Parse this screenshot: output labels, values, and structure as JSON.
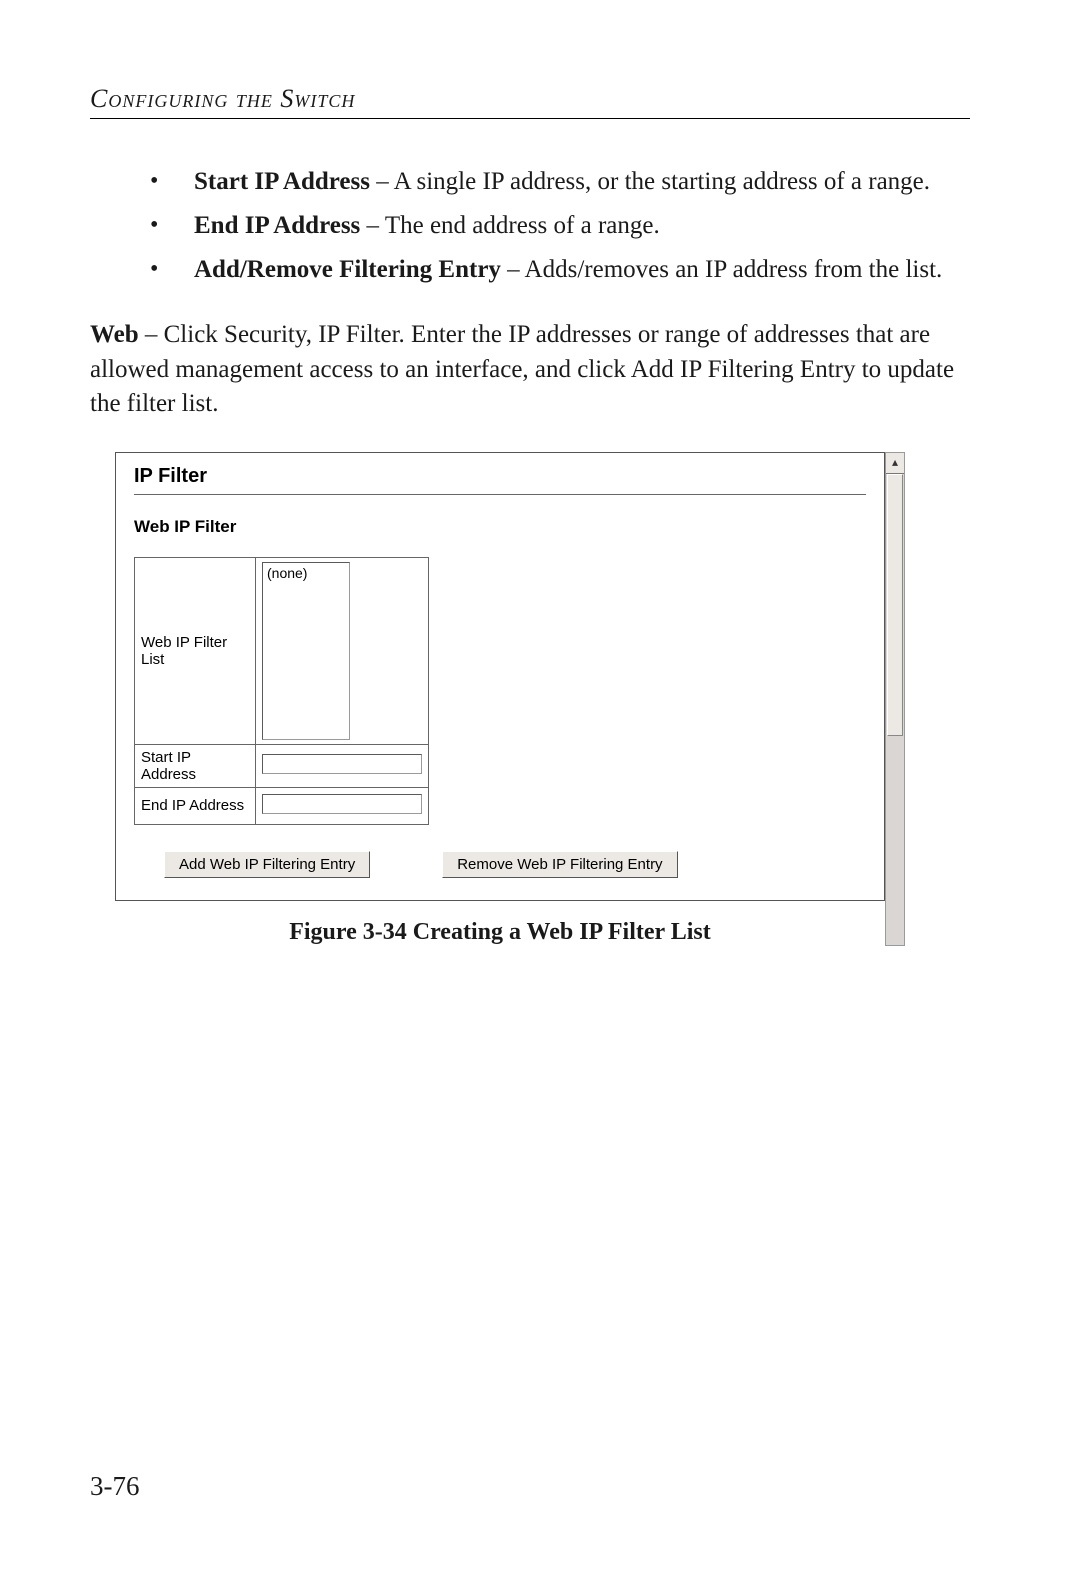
{
  "header": "Configuring the Switch",
  "bullets": [
    {
      "bold": "Start IP Address",
      "rest": " – A single IP address, or the starting address of a range."
    },
    {
      "bold": "End IP Address",
      "rest": " – The end address of a range."
    },
    {
      "bold": "Add/Remove Filtering Entry",
      "rest": " – Adds/removes an IP address from the list."
    }
  ],
  "web_para": {
    "bold": "Web",
    "rest": " – Click Security, IP Filter. Enter the IP addresses or range of addresses that are allowed management access to an interface, and click Add IP Filtering Entry to update the filter list."
  },
  "shot": {
    "title": "IP Filter",
    "section": "Web IP Filter",
    "list_label": "Web IP Filter List",
    "list_value": "(none)",
    "start_label": "Start IP Address",
    "start_value": "",
    "end_label": "End IP Address",
    "end_value": "",
    "add_btn": "Add Web IP Filtering Entry",
    "remove_btn": "Remove Web IP Filtering Entry",
    "scroll_up_glyph": "▴"
  },
  "figure_caption": "Figure 3-34  Creating a Web IP Filter List",
  "page_number": "3-76"
}
